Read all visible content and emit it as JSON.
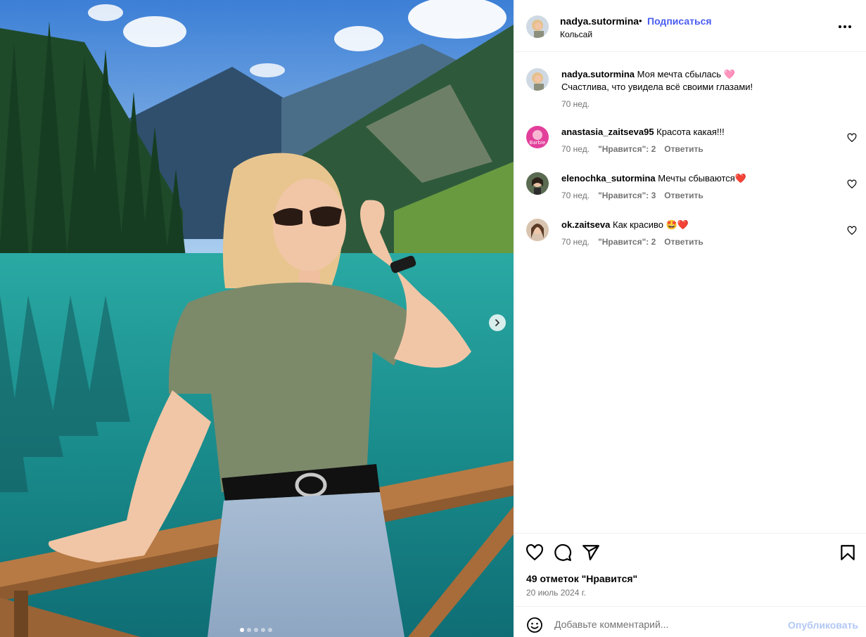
{
  "post": {
    "username": "nadya.sutormina",
    "separator": "•",
    "follow_label": "Подписаться",
    "location": "Кольсай",
    "caption_line1": "Моя мечта сбылась 🩷",
    "caption_line2": "Счастлива, что увидела всё своими глазами!",
    "caption_time": "70 нед.",
    "likes_text": "49 отметок \"Нравится\"",
    "date_text": "20 июль 2024 г.",
    "carousel": {
      "total": 5,
      "active_index": 0
    }
  },
  "comments": [
    {
      "username": "anastasia_zaitseva95",
      "text": "Красота какая!!!",
      "time": "70 нед.",
      "likes": "\"Нравится\": 2",
      "reply": "Ответить"
    },
    {
      "username": "elenochka_sutormina",
      "text": "Мечты сбываются❤️",
      "time": "70 нед.",
      "likes": "\"Нравится\": 3",
      "reply": "Ответить"
    },
    {
      "username": "ok.zaitseva",
      "text": "Как красиво 🤩❤️",
      "time": "70 нед.",
      "likes": "\"Нравится\": 2",
      "reply": "Ответить"
    }
  ],
  "composer": {
    "placeholder": "Добавьте комментарий...",
    "post_label": "Опубликовать"
  },
  "icons": {
    "next": "chevron-right-icon",
    "more": "more-horizontal-icon",
    "like": "heart-icon",
    "comment": "comment-icon",
    "share": "send-icon",
    "save": "bookmark-icon",
    "emoji": "emoji-icon"
  },
  "colors": {
    "follow": "#4a5cf0",
    "post_button": "#b2c7f4",
    "muted": "#737373"
  }
}
